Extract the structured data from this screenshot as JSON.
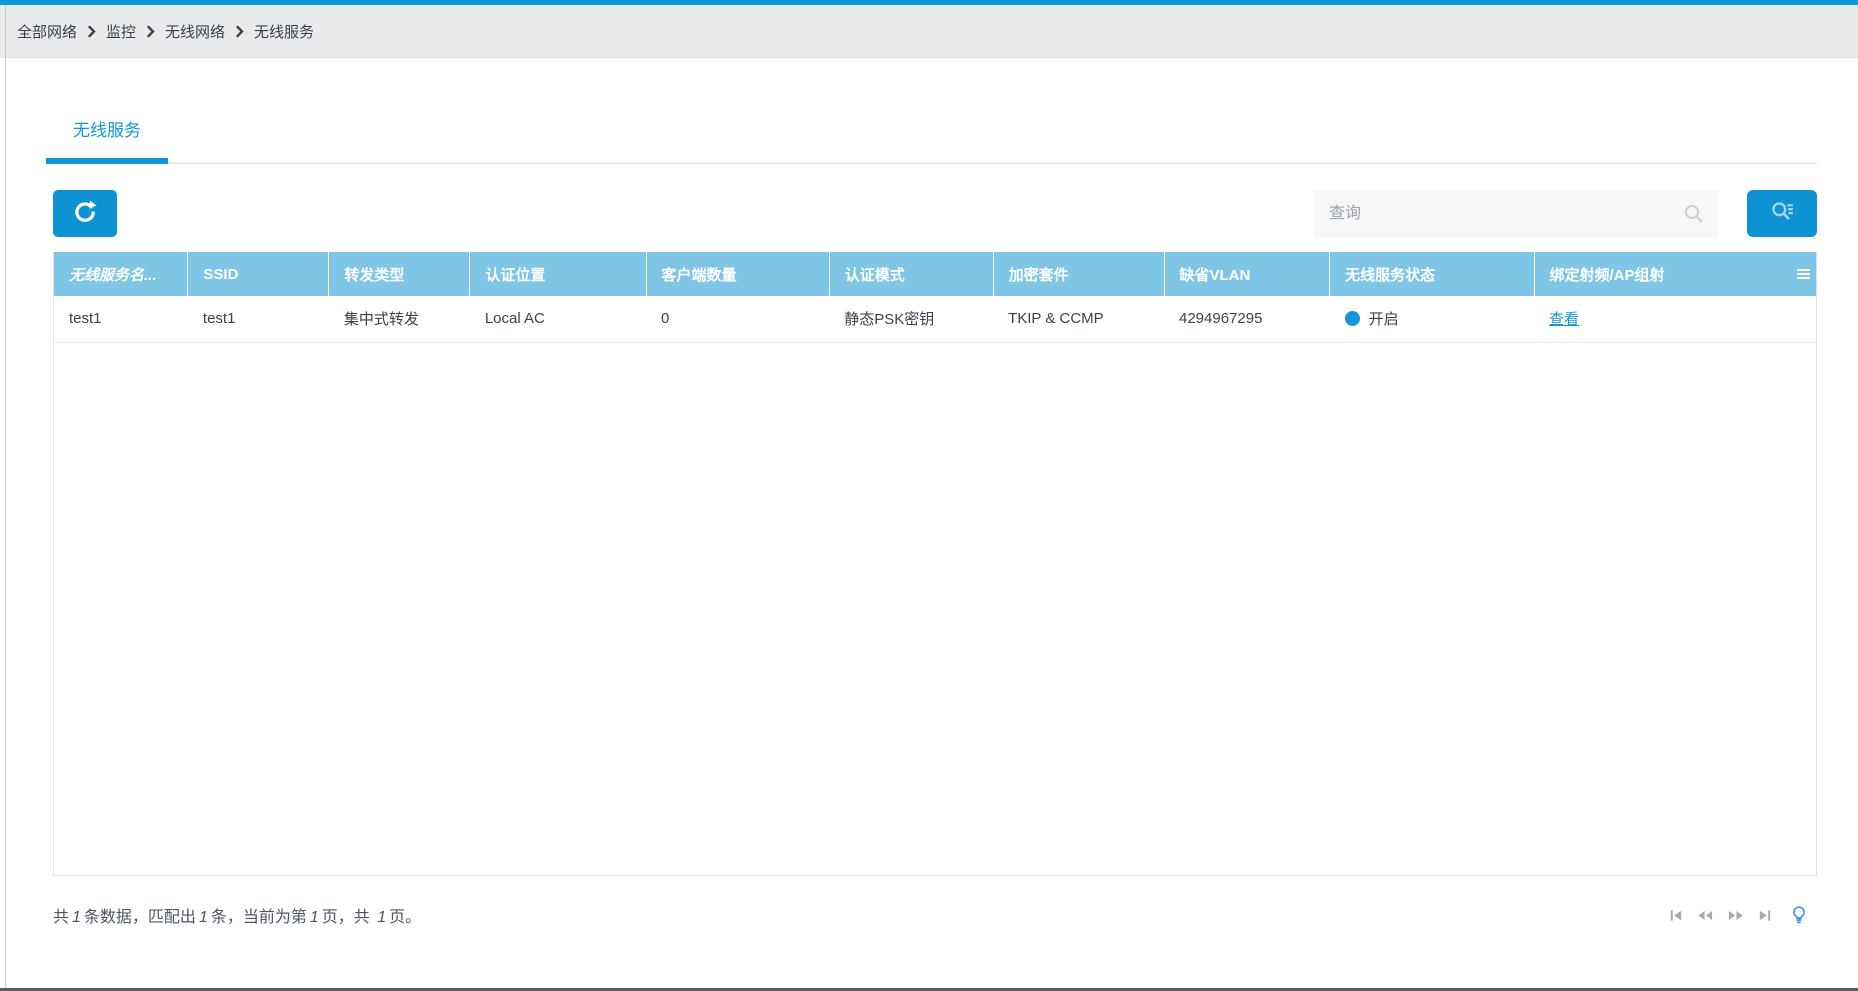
{
  "breadcrumb": {
    "items": [
      "全部网络",
      "监控",
      "无线网络",
      "无线服务"
    ]
  },
  "tabs": {
    "active_label": "无线服务"
  },
  "toolbar": {
    "refresh_icon": "refresh-icon",
    "search_placeholder": "查询",
    "search_value": "",
    "advanced_search_icon": "advanced-search-icon"
  },
  "table": {
    "columns": [
      "无线服务名...",
      "SSID",
      "转发类型",
      "认证位置",
      "客户端数量",
      "认证模式",
      "加密套件",
      "缺省VLAN",
      "无线服务状态",
      "绑定射频/AP组射"
    ],
    "rows": [
      {
        "service_name": "test1",
        "ssid": "test1",
        "forward_type": "集中式转发",
        "auth_location": "Local AC",
        "client_count": "0",
        "auth_mode": "静态PSK密钥",
        "cipher_suite": "TKIP & CCMP",
        "default_vlan": "4294967295",
        "status_label": "开启",
        "action_label": "查看"
      }
    ]
  },
  "footer": {
    "summary_parts": [
      {
        "text": "共",
        "num": false
      },
      {
        "text": "1",
        "num": true
      },
      {
        "text": "条数据，匹配出",
        "num": false
      },
      {
        "text": "1",
        "num": true
      },
      {
        "text": "条，当前为第",
        "num": false
      },
      {
        "text": "1",
        "num": true
      },
      {
        "text": "页，共 ",
        "num": false
      },
      {
        "text": "1",
        "num": true
      },
      {
        "text": "页。",
        "num": false
      }
    ]
  },
  "colors": {
    "accent_blue": "#1296db",
    "topbar_blue": "#0e97d7",
    "table_header_bg": "#7fc5e5",
    "status_on_dot": "#1296db",
    "breadcrumb_bg": "#e9eaec",
    "bulb_blue": "#3f8cf3"
  }
}
